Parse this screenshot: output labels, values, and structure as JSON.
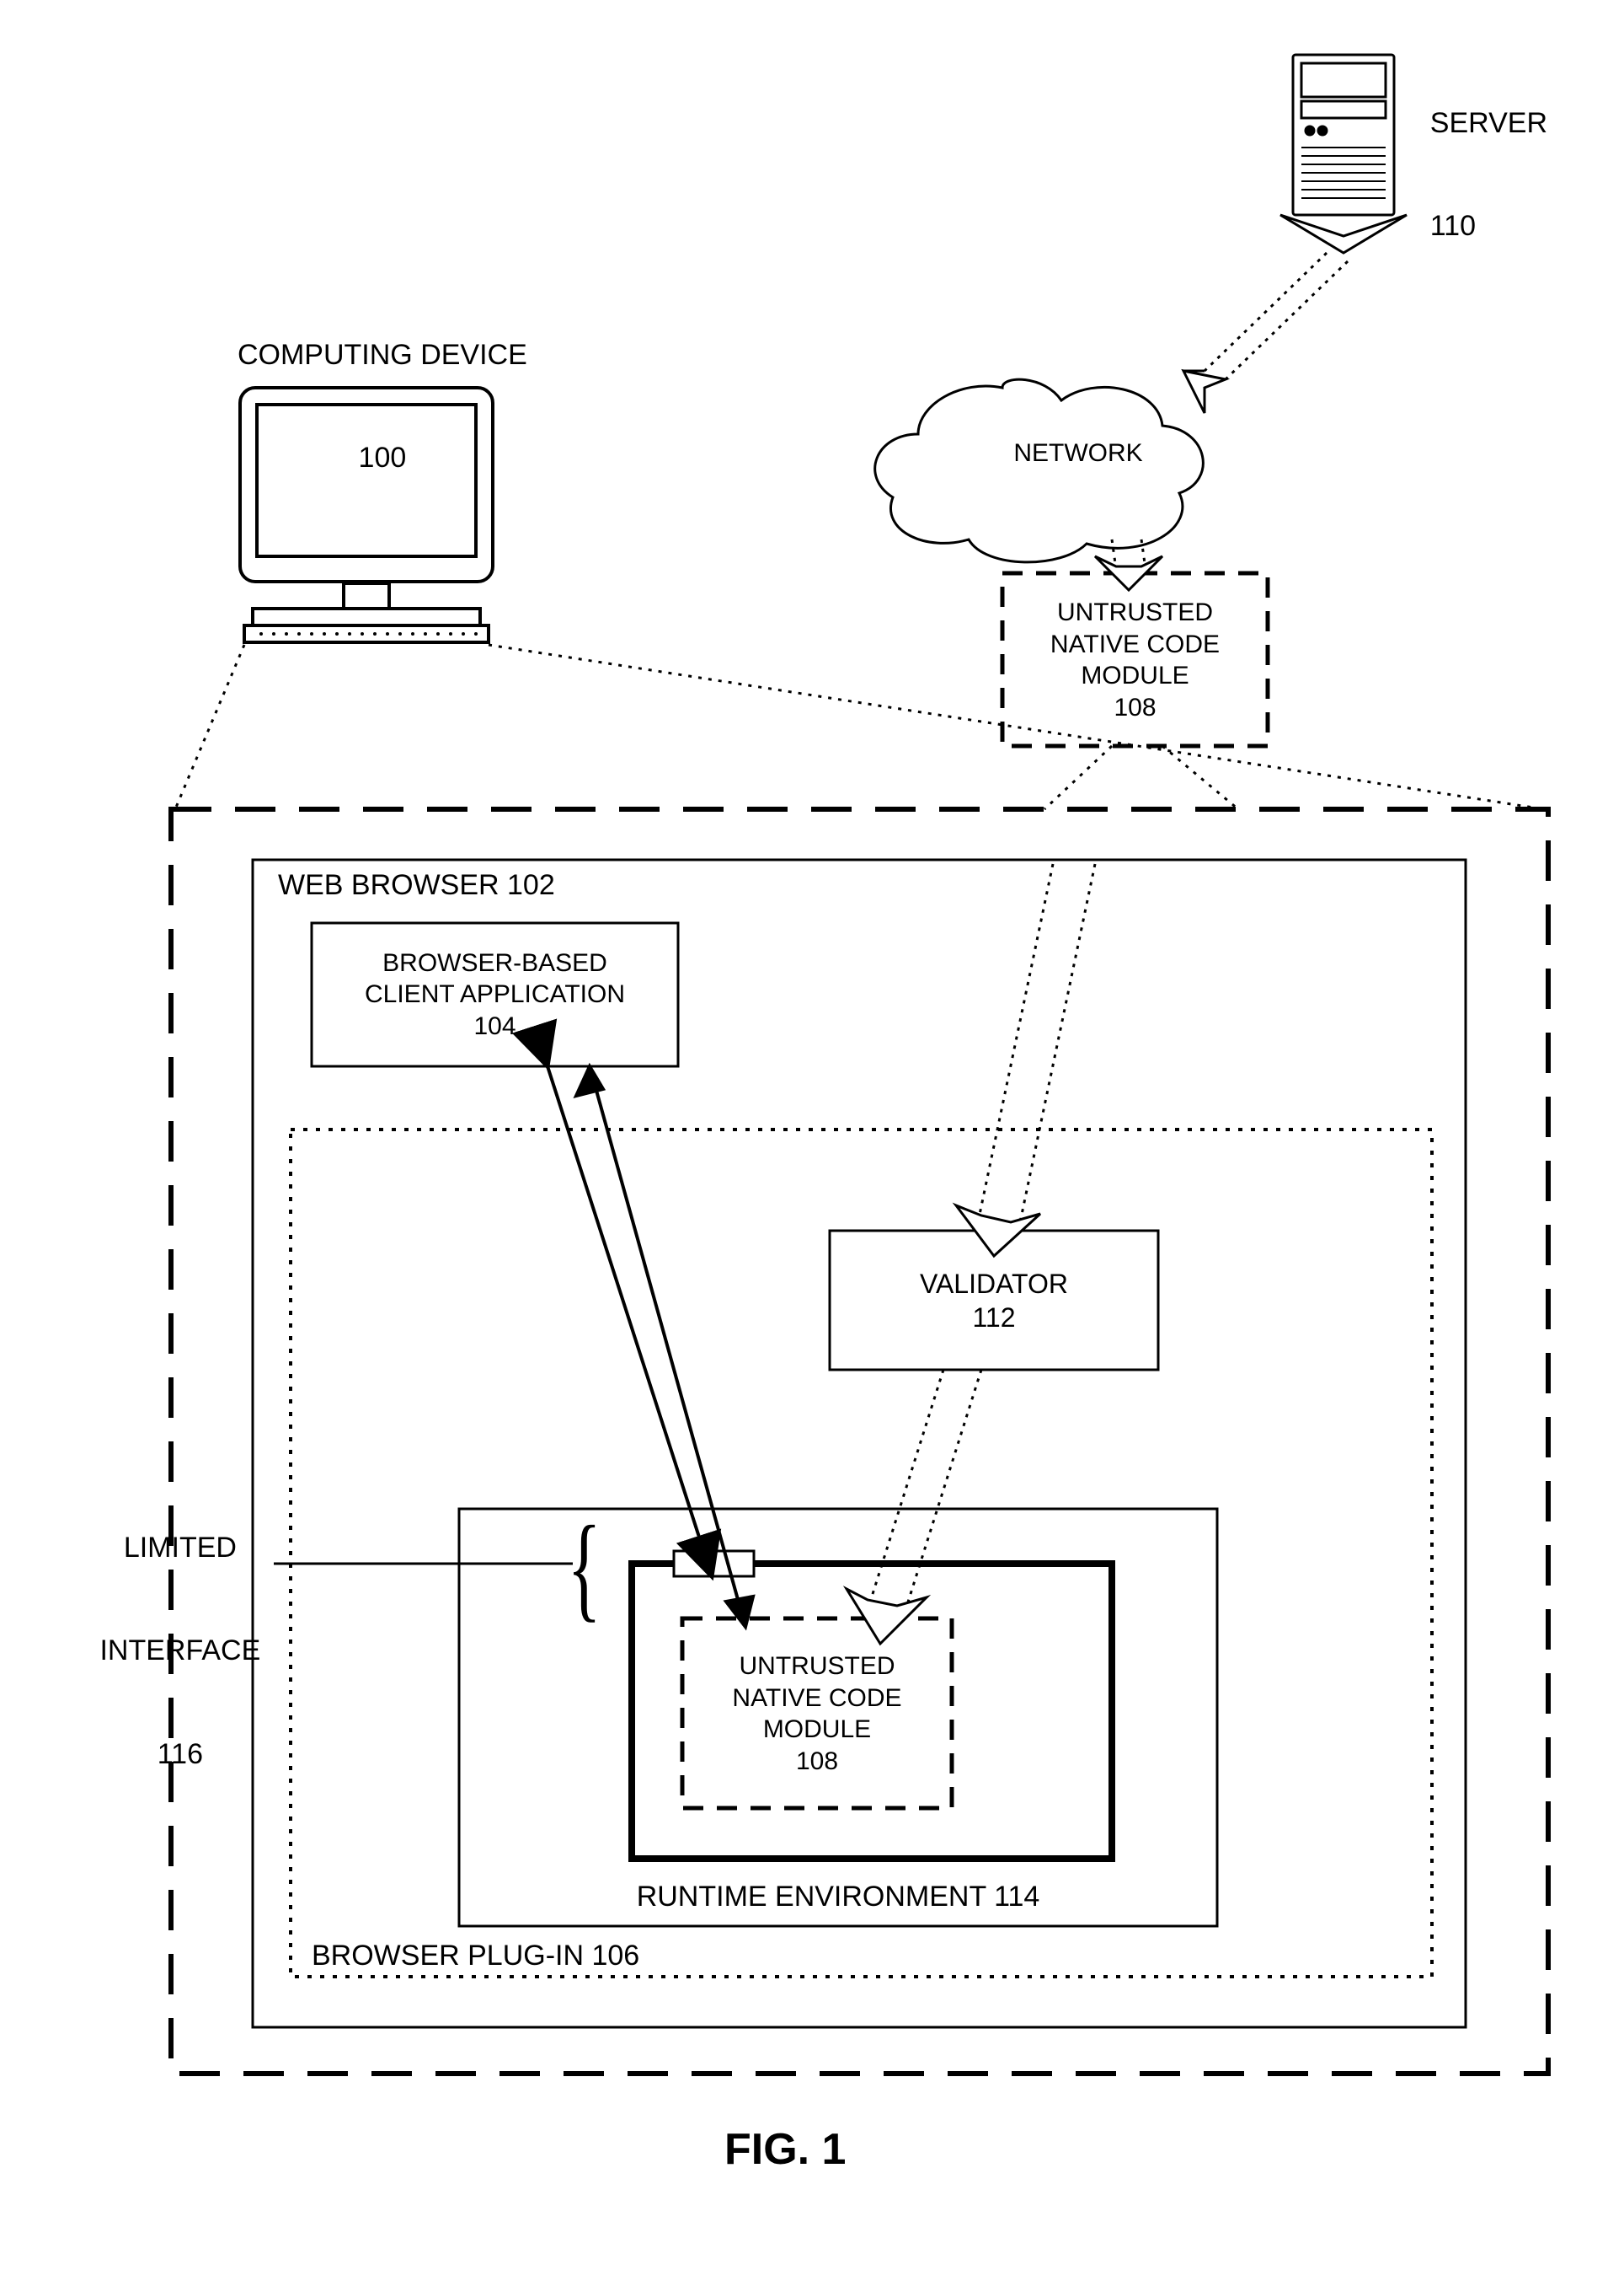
{
  "figure_caption": "FIG. 1",
  "computing_device": {
    "title": "COMPUTING DEVICE",
    "num": "100"
  },
  "server": {
    "title": "SERVER",
    "num": "110"
  },
  "network": {
    "title": "NETWORK"
  },
  "untrusted_module": {
    "l1": "UNTRUSTED",
    "l2": "NATIVE CODE",
    "l3": "MODULE",
    "num": "108"
  },
  "web_browser": {
    "title": "WEB BROWSER 102"
  },
  "browser_client_app": {
    "l1": "BROWSER-BASED",
    "l2": "CLIENT APPLICATION",
    "num": "104"
  },
  "validator": {
    "title": "VALIDATOR",
    "num": "112"
  },
  "runtime_env": {
    "title": "RUNTIME ENVIRONMENT 114"
  },
  "browser_plugin": {
    "title": "BROWSER PLUG-IN 106"
  },
  "limited_interface": {
    "l1": "LIMITED",
    "l2": "INTERFACE",
    "num": "116"
  },
  "untrusted_module_inner": {
    "l1": "UNTRUSTED",
    "l2": "NATIVE CODE",
    "l3": "MODULE",
    "num": "108"
  }
}
